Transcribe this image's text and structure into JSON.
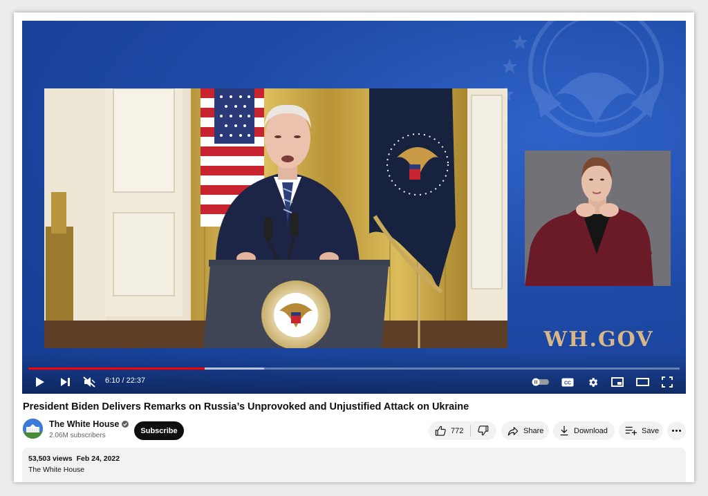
{
  "player": {
    "watermark_text": "WH.GOV",
    "time_current": "6:10",
    "time_total": "22:37",
    "time_display": "6:10 / 22:37",
    "progress_played": 0.271,
    "progress_loaded": 0.362,
    "muted": true,
    "autoplay_on": false,
    "accent_color": "#ff0000",
    "icons": [
      "play-icon",
      "next-icon",
      "mute-icon",
      "autoplay-toggle-icon",
      "captions-icon",
      "settings-icon",
      "miniplayer-icon",
      "theater-icon",
      "fullscreen-icon"
    ]
  },
  "video": {
    "title": "President Biden Delivers Remarks on Russia’s Unprovoked and Unjustified Attack on Ukraine"
  },
  "channel": {
    "name": "The White House",
    "subscribers": "2.06M subscribers",
    "verified": true,
    "subscribe_label": "Subscribe"
  },
  "actions": {
    "likes": "772",
    "share_label": "Share",
    "download_label": "Download",
    "save_label": "Save"
  },
  "description": {
    "views": "53,503 views",
    "date": "Feb 24, 2022",
    "text": "The White House"
  }
}
